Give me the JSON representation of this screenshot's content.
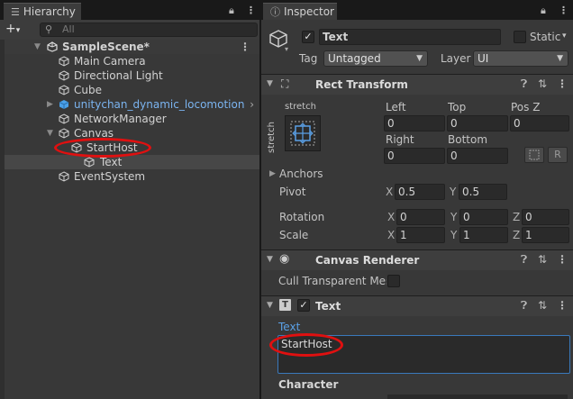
{
  "hierarchy": {
    "tab_title": "Hierarchy",
    "search_placeholder": "All",
    "scene_name": "SampleScene*",
    "items": [
      {
        "label": "Main Camera"
      },
      {
        "label": "Directional Light"
      },
      {
        "label": "Cube"
      },
      {
        "label": "unitychan_dynamic_locomotion"
      },
      {
        "label": "NetworkManager"
      },
      {
        "label": "Canvas"
      },
      {
        "label": "StartHost"
      },
      {
        "label": "Text"
      },
      {
        "label": "EventSystem"
      }
    ]
  },
  "inspector": {
    "tab_title": "Inspector",
    "object_name": "Text",
    "static_label": "Static",
    "tag_label": "Tag",
    "tag_value": "Untagged",
    "layer_label": "Layer",
    "layer_value": "UI",
    "rect_transform": {
      "title": "Rect Transform",
      "anchor_preset_top": "stretch",
      "anchor_preset_side": "stretch",
      "left_label": "Left",
      "left_value": "0",
      "top_label": "Top",
      "top_value": "0",
      "posz_label": "Pos Z",
      "posz_value": "0",
      "right_label": "Right",
      "right_value": "0",
      "bottom_label": "Bottom",
      "bottom_value": "0",
      "r_button": "R",
      "anchors_label": "Anchors",
      "pivot_label": "Pivot",
      "pivot_x": "0.5",
      "pivot_y": "0.5",
      "rotation_label": "Rotation",
      "rot_x": "0",
      "rot_y": "0",
      "rot_z": "0",
      "scale_label": "Scale",
      "scale_x": "1",
      "scale_y": "1",
      "scale_z": "1",
      "x": "X",
      "y": "Y",
      "z": "Z"
    },
    "canvas_renderer": {
      "title": "Canvas Renderer",
      "cull_label": "Cull Transparent Mes"
    },
    "text_component": {
      "title": "Text",
      "text_label": "Text",
      "text_value": "StartHost",
      "character_label": "Character"
    }
  }
}
